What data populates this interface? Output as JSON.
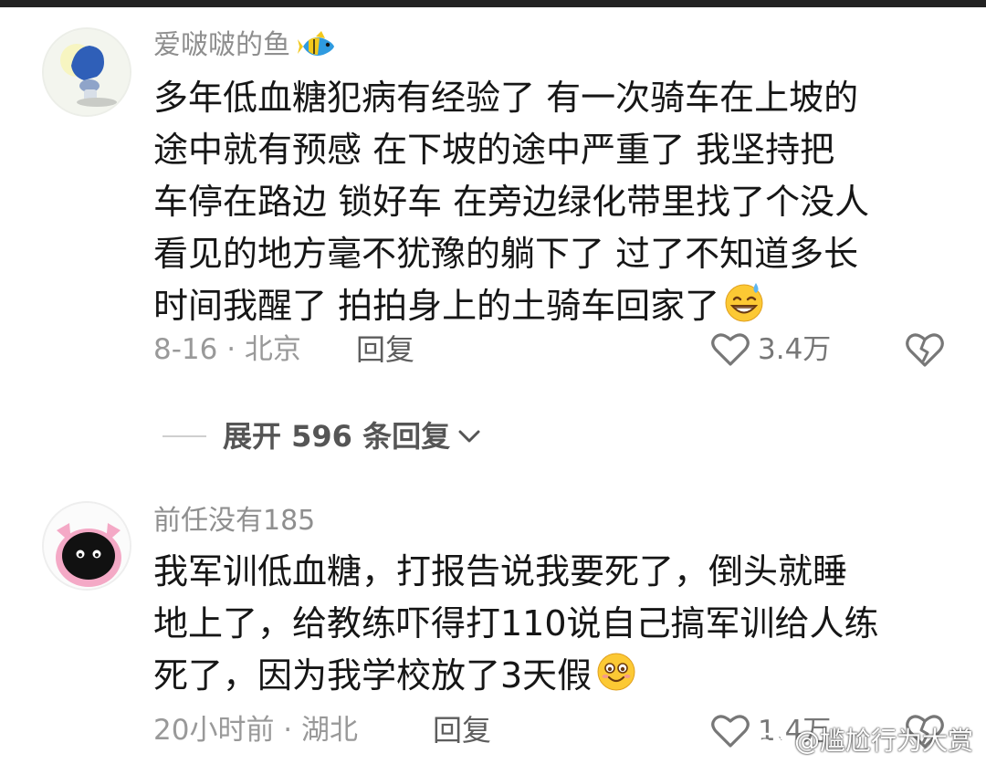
{
  "comments": [
    {
      "username": "爱啵啵的鱼",
      "username_emoji": "tropical-fish-icon",
      "text": "多年低血糖犯病有经验了  有一次骑车在上坡的\n途中就有预感  在下坡的途中严重了  我坚持把\n车停在路边 锁好车  在旁边绿化带里找了个没人\n看见的地方毫不犹豫的躺下了  过了不知道多长\n时间我醒了  拍拍身上的土骑车回家了",
      "text_emoji": "grinning-sweat-emoji",
      "meta": "8-16 · 北京",
      "reply_label": "回复",
      "like_count": "3.4万"
    },
    {
      "username": "前任没有185",
      "text": "我军训低血糖，打报告说我要死了，倒头就睡\n地上了，给教练吓得打110说自己搞军训给人练\n死了，因为我学校放了3天假",
      "text_emoji": "smiling-emoji",
      "meta": "20小时前 · 湖北",
      "reply_label": "回复",
      "like_count": "1.4万"
    }
  ],
  "expand_replies_label": "展开 596 条回复",
  "watermark": "@尴尬行为大赏",
  "colors": {
    "username": "#8f8f8f",
    "text": "#161616",
    "meta": "#999999",
    "heart_outline": "#777777"
  }
}
